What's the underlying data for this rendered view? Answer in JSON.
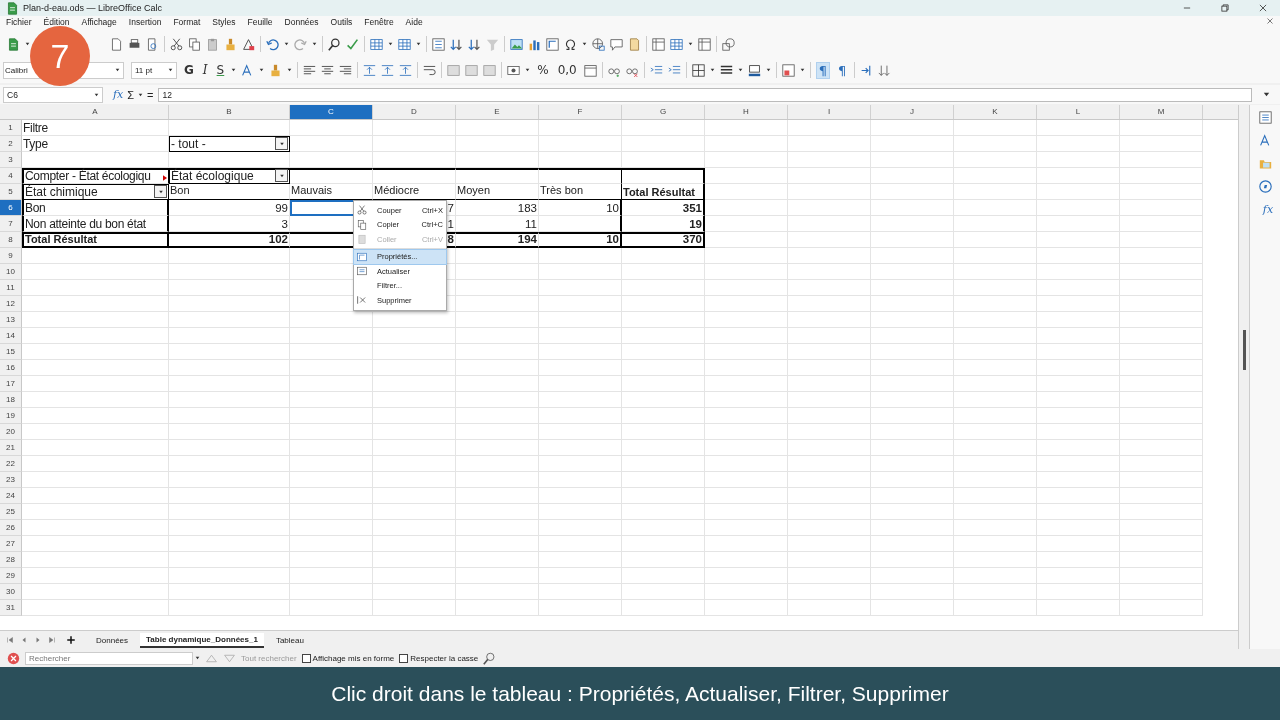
{
  "window": {
    "title": "Plan-d-eau.ods — LibreOffice Calc"
  },
  "menu": [
    "Fichier",
    "Édition",
    "Affichage",
    "Insertion",
    "Format",
    "Styles",
    "Feuille",
    "Données",
    "Outils",
    "Fenêtre",
    "Aide"
  ],
  "format_toolbar": {
    "font": "Calibri",
    "size": "11 pt",
    "glyphs": [
      "G",
      "I",
      "S",
      "%",
      "0,0"
    ],
    "toggles": [
      {
        "label": "¶",
        "selected": true
      },
      {
        "label": "¶",
        "selected": false
      }
    ]
  },
  "formula_bar": {
    "cell": "C6",
    "fx": "fx",
    "sum": "Σ",
    "equals": "=",
    "value": "12"
  },
  "columns": [
    {
      "label": "A",
      "selected": false
    },
    {
      "label": "B",
      "selected": false
    },
    {
      "label": "C",
      "selected": true
    },
    {
      "label": "D",
      "selected": false
    },
    {
      "label": "E",
      "selected": false
    },
    {
      "label": "F",
      "selected": false
    },
    {
      "label": "G",
      "selected": false
    },
    {
      "label": "H",
      "selected": false
    },
    {
      "label": "I",
      "selected": false
    },
    {
      "label": "J",
      "selected": false
    },
    {
      "label": "K",
      "selected": false
    },
    {
      "label": "L",
      "selected": false
    },
    {
      "label": "M",
      "selected": false
    }
  ],
  "rows": [
    {
      "number": "1",
      "selected": false,
      "kind": "plain",
      "cells": [
        {
          "kind": "label",
          "text": "Filtre"
        }
      ]
    },
    {
      "number": "2",
      "selected": false,
      "kind": "plain",
      "cells": [
        {
          "kind": "label",
          "text": "Type"
        },
        {
          "kind": "dropdown",
          "text": "- tout -"
        }
      ]
    },
    {
      "number": "3",
      "selected": false,
      "kind": "plain",
      "cells": []
    },
    {
      "number": "4",
      "selected": false,
      "kind": "pivot-top",
      "cells": [
        {
          "kind": "label",
          "text": "Compter - État écologiqu",
          "overflow": true
        },
        {
          "kind": "dropdown",
          "text": "État écologique"
        }
      ]
    },
    {
      "number": "5",
      "selected": false,
      "kind": "pivot-head",
      "cells": [
        {
          "kind": "dropdown",
          "text": "État chimique"
        },
        {
          "kind": "small",
          "text": "Bon"
        },
        {
          "kind": "small",
          "text": "Mauvais"
        },
        {
          "kind": "small",
          "text": "Médiocre"
        },
        {
          "kind": "small",
          "text": "Moyen"
        },
        {
          "kind": "small",
          "text": "Très bon"
        },
        {
          "kind": "bold",
          "text": "Total Résultat"
        }
      ]
    },
    {
      "number": "6",
      "selected": true,
      "kind": "pivot-body",
      "cells": [
        {
          "kind": "label",
          "text": "Bon"
        },
        {
          "kind": "number",
          "text": "99"
        },
        {
          "kind": "empty"
        },
        {
          "kind": "number",
          "text": "7"
        },
        {
          "kind": "number",
          "text": "183"
        },
        {
          "kind": "number",
          "text": "10"
        },
        {
          "kind": "bold-number",
          "text": "351"
        }
      ]
    },
    {
      "number": "7",
      "selected": false,
      "kind": "pivot-body",
      "cells": [
        {
          "kind": "label",
          "text": "Non atteinte du bon état"
        },
        {
          "kind": "number",
          "text": "3"
        },
        {
          "kind": "empty"
        },
        {
          "kind": "number",
          "text": "1"
        },
        {
          "kind": "number",
          "text": "11"
        },
        {
          "kind": "empty"
        },
        {
          "kind": "bold-number",
          "text": "19"
        }
      ]
    },
    {
      "number": "8",
      "selected": false,
      "kind": "pivot-total",
      "cells": [
        {
          "kind": "bold",
          "text": "Total Résultat"
        },
        {
          "kind": "bold-number",
          "text": "102"
        },
        {
          "kind": "empty"
        },
        {
          "kind": "bold-number",
          "text": "8"
        },
        {
          "kind": "bold-number",
          "text": "194"
        },
        {
          "kind": "bold-number",
          "text": "10"
        },
        {
          "kind": "bold-number",
          "text": "370"
        }
      ]
    },
    {
      "number": "9",
      "selected": false,
      "kind": "plain",
      "cells": []
    },
    {
      "number": "10",
      "selected": false,
      "kind": "plain",
      "cells": []
    },
    {
      "number": "11",
      "selected": false,
      "kind": "plain",
      "cells": []
    },
    {
      "number": "12",
      "selected": false,
      "kind": "plain",
      "cells": []
    },
    {
      "number": "13",
      "selected": false,
      "kind": "plain",
      "cells": []
    },
    {
      "number": "14",
      "selected": false,
      "kind": "plain",
      "cells": []
    },
    {
      "number": "15",
      "selected": false,
      "kind": "plain",
      "cells": []
    },
    {
      "number": "16",
      "selected": false,
      "kind": "plain",
      "cells": []
    },
    {
      "number": "17",
      "selected": false,
      "kind": "plain",
      "cells": []
    },
    {
      "number": "18",
      "selected": false,
      "kind": "plain",
      "cells": []
    },
    {
      "number": "19",
      "selected": false,
      "kind": "plain",
      "cells": []
    },
    {
      "number": "20",
      "selected": false,
      "kind": "plain",
      "cells": []
    },
    {
      "number": "21",
      "selected": false,
      "kind": "plain",
      "cells": []
    },
    {
      "number": "22",
      "selected": false,
      "kind": "plain",
      "cells": []
    },
    {
      "number": "23",
      "selected": false,
      "kind": "plain",
      "cells": []
    },
    {
      "number": "24",
      "selected": false,
      "kind": "plain",
      "cells": []
    },
    {
      "number": "25",
      "selected": false,
      "kind": "plain",
      "cells": []
    },
    {
      "number": "26",
      "selected": false,
      "kind": "plain",
      "cells": []
    },
    {
      "number": "27",
      "selected": false,
      "kind": "plain",
      "cells": []
    },
    {
      "number": "28",
      "selected": false,
      "kind": "plain",
      "cells": []
    },
    {
      "number": "29",
      "selected": false,
      "kind": "plain",
      "cells": []
    },
    {
      "number": "30",
      "selected": false,
      "kind": "plain",
      "cells": []
    },
    {
      "number": "31",
      "selected": false,
      "kind": "plain",
      "cells": []
    }
  ],
  "context_menu": [
    {
      "kind": "cut",
      "label": "Couper",
      "shortcut": "Ctrl+X",
      "disabled": false,
      "selected": false
    },
    {
      "kind": "copy",
      "label": "Copier",
      "shortcut": "Ctrl+C",
      "disabled": false,
      "selected": false
    },
    {
      "kind": "paste",
      "label": "Coller",
      "shortcut": "Ctrl+V",
      "disabled": true,
      "selected": false
    },
    {
      "kind": "properties",
      "label": "Propriétés...",
      "disabled": false,
      "selected": true
    },
    {
      "kind": "refresh",
      "label": "Actualiser",
      "disabled": false,
      "selected": false
    },
    {
      "kind": "plain",
      "label": "Filtrer...",
      "disabled": false,
      "selected": false
    },
    {
      "kind": "delete",
      "label": "Supprimer",
      "disabled": false,
      "selected": false
    }
  ],
  "sheet_tabs": [
    {
      "label": "Données",
      "selected": false
    },
    {
      "label": "Table dynamique_Données_1",
      "selected": true
    },
    {
      "label": "Tableau",
      "selected": false
    }
  ],
  "find_bar": {
    "placeholder": "Rechercher",
    "find_all": "Tout rechercher",
    "options": [
      {
        "label": "Affichage mis en forme",
        "checked": false
      },
      {
        "label": "Respecter la casse",
        "checked": false
      }
    ]
  },
  "sidebar": {
    "fx": "fx"
  },
  "step_badge": "7",
  "caption": "Clic droit dans le tableau : Propriétés, Actualiser, Filtrer, Supprimer"
}
